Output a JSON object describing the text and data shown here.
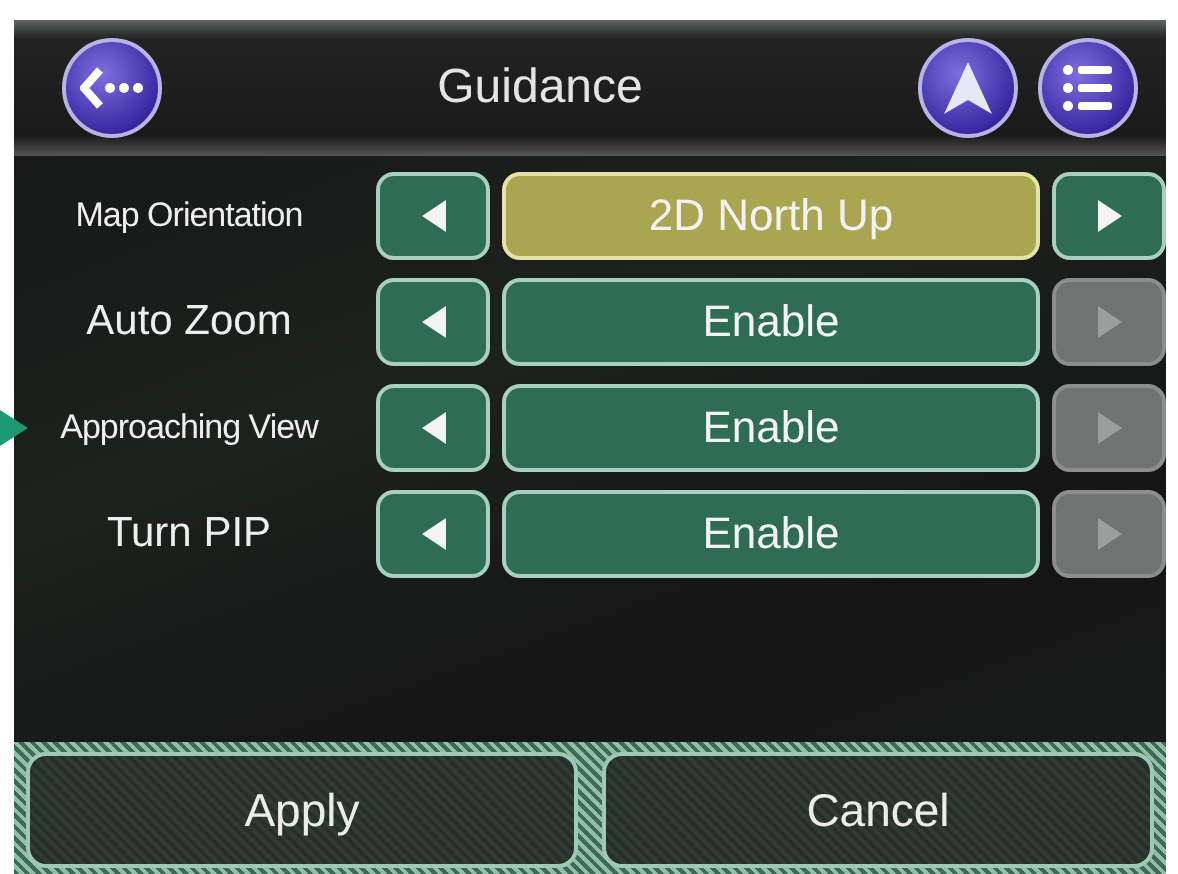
{
  "header": {
    "title": "Guidance"
  },
  "settings": [
    {
      "label": "Map Orientation",
      "value": "2D North Up",
      "selected": true,
      "prev_disabled": false,
      "next_disabled": false,
      "pointed": false
    },
    {
      "label": "Auto Zoom",
      "value": "Enable",
      "selected": false,
      "prev_disabled": false,
      "next_disabled": true,
      "pointed": false
    },
    {
      "label": "Approaching View",
      "value": "Enable",
      "selected": false,
      "prev_disabled": false,
      "next_disabled": true,
      "pointed": true
    },
    {
      "label": "Turn PIP",
      "value": "Enable",
      "selected": false,
      "prev_disabled": false,
      "next_disabled": true,
      "pointed": false
    }
  ],
  "buttons": [
    "Apply",
    "Cancel"
  ]
}
